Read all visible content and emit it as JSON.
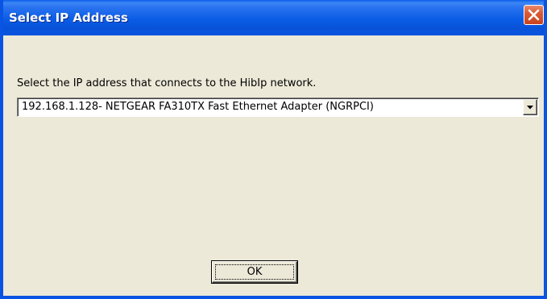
{
  "window": {
    "title": "Select IP Address",
    "close_icon": "close-x-icon",
    "titlebar_color": "#0a5ee8",
    "close_color": "#d95b35",
    "background_color": "#ece9d8"
  },
  "dialog": {
    "prompt": "Select the IP address that connects to the HibIp network.",
    "ip_select": {
      "selected_value": "192.168.1.128- NETGEAR FA310TX Fast Ethernet Adapter (NGRPCI)",
      "arrow_icon": "chevron-down-icon"
    },
    "ok_label": "OK"
  }
}
